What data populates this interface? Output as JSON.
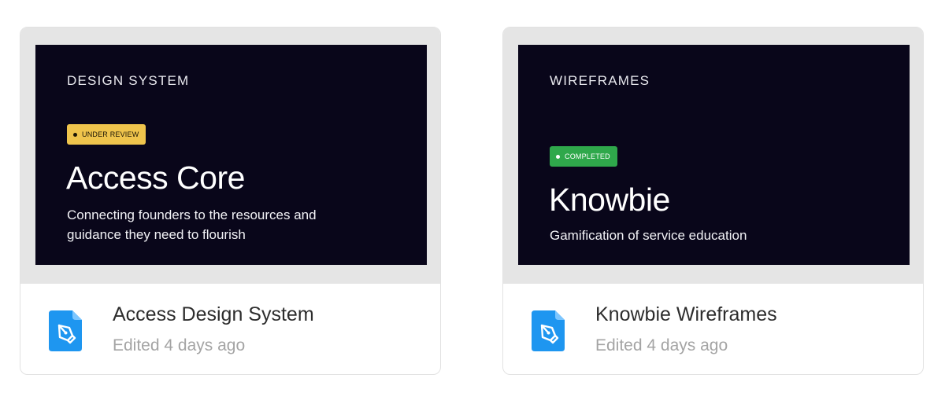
{
  "cards": [
    {
      "category": "DESIGN SYSTEM",
      "badge": "UNDER REVIEW",
      "project_name": "Access Core",
      "tagline": "Connecting founders to the resources and guidance they need to flourish",
      "file_name": "Access Design System",
      "edited": "Edited 4 days ago",
      "icon": "pen-tool-file-icon"
    },
    {
      "category": "WIREFRAMES",
      "badge": "COMPLETED",
      "project_name": "Knowbie",
      "tagline": "Gamification of service education",
      "file_name": "Knowbie Wireframes",
      "edited": "Edited 4 days ago",
      "icon": "pen-tool-file-icon"
    }
  ],
  "colors": {
    "thumbnail_bg": "#09061a",
    "under_review": "#efc44c",
    "completed": "#2fa84b",
    "file_icon": "#1e96f0"
  }
}
